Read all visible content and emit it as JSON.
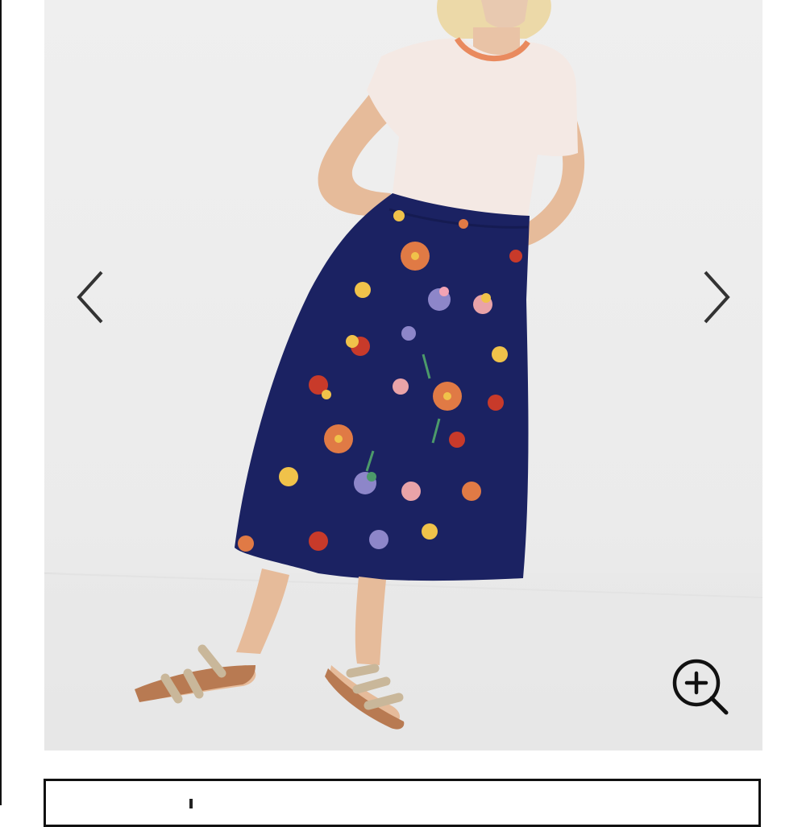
{
  "colors": {
    "arrow": "#333333",
    "skirt": "#1b2262",
    "wall": "#ececec",
    "floor": "#e6e6e6"
  },
  "gallery": {
    "prev_icon": "chevron-left-icon",
    "next_icon": "chevron-right-icon",
    "zoom_icon": "zoom-in-icon"
  }
}
